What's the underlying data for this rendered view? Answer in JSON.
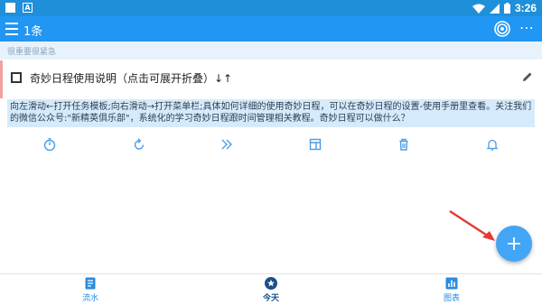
{
  "status_bar": {
    "time": "3:26",
    "notification_letter": "A"
  },
  "app_bar": {
    "title": "1条",
    "more": "⋯"
  },
  "category": {
    "label": "很重要很紧急"
  },
  "task": {
    "title": "奇妙日程使用说明（点击可展开折叠）↓↑",
    "note": "向左滑动←打开任务模板;向右滑动→打开菜单栏;具体如何详细的使用奇妙日程，可以在奇妙日程的设置-使用手册里查看。关注我们的微信公众号:\"新精英俱乐部\"，系统化的学习奇妙日程跟时间管理相关教程。奇妙日程可以做什么？",
    "accent_color": "#f2a1a1"
  },
  "actions": [
    {
      "icon": "stopwatch-icon"
    },
    {
      "icon": "refresh-icon"
    },
    {
      "icon": "double-chevron-right-icon"
    },
    {
      "icon": "layout-icon"
    },
    {
      "icon": "trash-icon"
    },
    {
      "icon": "bell-icon"
    }
  ],
  "fab": {
    "icon": "plus-icon"
  },
  "bottom_nav": {
    "items": [
      {
        "label": "流水",
        "icon": "document-icon"
      },
      {
        "label": "今天",
        "icon": "star-icon"
      },
      {
        "label": "图表",
        "icon": "bar-chart-icon"
      }
    ]
  },
  "colors": {
    "primary": "#2196f3",
    "status_bar": "#1f8fd9",
    "accent": "#42a5f5",
    "arrow": "#e53935"
  }
}
